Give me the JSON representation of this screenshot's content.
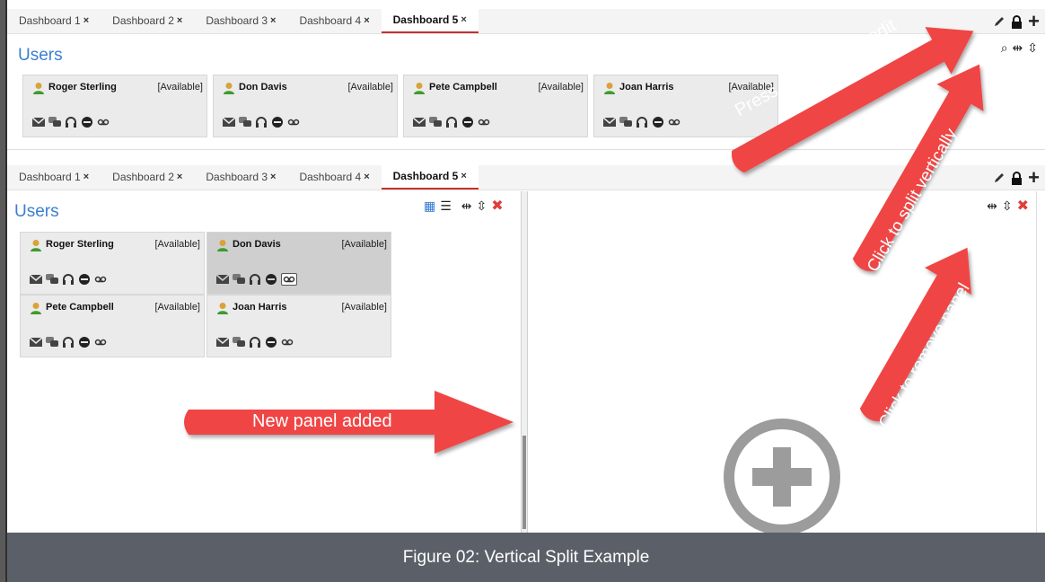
{
  "top_dashboard": {
    "tabs": [
      {
        "label": "Dashboard 1",
        "close": "×"
      },
      {
        "label": "Dashboard 2",
        "close": "×"
      },
      {
        "label": "Dashboard 3",
        "close": "×"
      },
      {
        "label": "Dashboard 4",
        "close": "×"
      },
      {
        "label": "Dashboard 5",
        "close": "×",
        "active": true
      }
    ],
    "panel_title": "Users",
    "users": [
      {
        "name": "Roger Sterling",
        "status": "[Available]"
      },
      {
        "name": "Don Davis",
        "status": "[Available]"
      },
      {
        "name": "Pete Campbell",
        "status": "[Available]"
      },
      {
        "name": "Joan Harris",
        "status": "[Available]"
      }
    ]
  },
  "bottom_dashboard": {
    "tabs": [
      {
        "label": "Dashboard 1",
        "close": "×"
      },
      {
        "label": "Dashboard 2",
        "close": "×"
      },
      {
        "label": "Dashboard 3",
        "close": "×"
      },
      {
        "label": "Dashboard 4",
        "close": "×"
      },
      {
        "label": "Dashboard 5",
        "close": "×",
        "active": true
      }
    ],
    "left_panel": {
      "title": "Users",
      "users": [
        {
          "name": "Roger Sterling",
          "status": "[Available]"
        },
        {
          "name": "Don Davis",
          "status": "[Available]"
        },
        {
          "name": "Pete Campbell",
          "status": "[Available]"
        },
        {
          "name": "Joan Harris",
          "status": "[Available]"
        }
      ]
    }
  },
  "annotations": {
    "lock": "Press Lock icon to edit",
    "split": "Click to split vertically",
    "remove": "Click to remove panel",
    "added": "New panel added"
  },
  "caption": "Figure 02: Vertical Split Example",
  "colors": {
    "accent_blue": "#3b7fd0",
    "tab_active_underline": "#c4322d",
    "annotation_red": "#f04545",
    "remove_red": "#e23b3b",
    "caption_bg": "#5b6068"
  }
}
